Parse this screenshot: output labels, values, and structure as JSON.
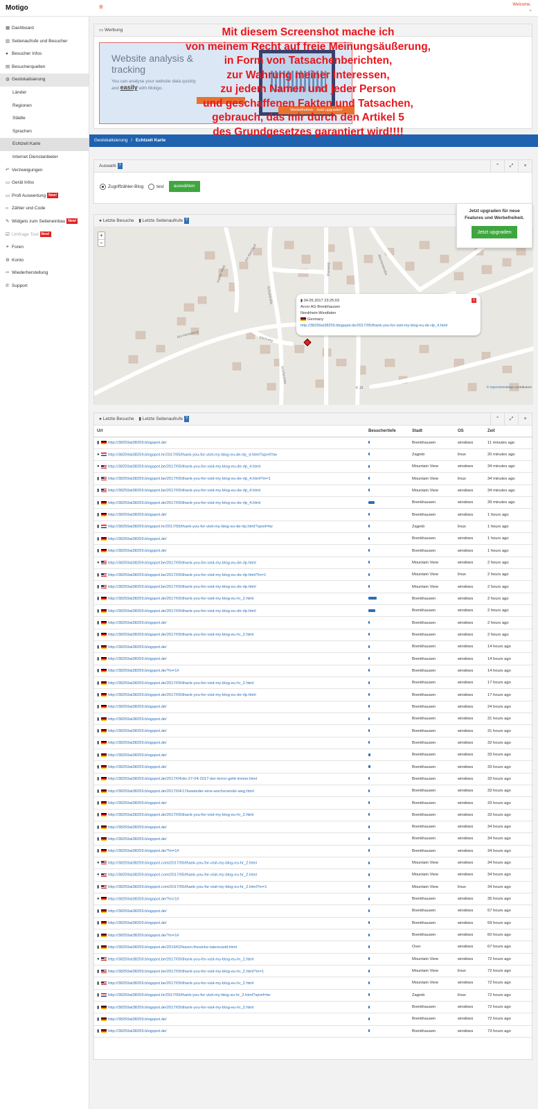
{
  "app": {
    "brand": "Motigo",
    "welcome": "Welcome,"
  },
  "sidebar": [
    {
      "label": "Dashboard",
      "icon": "dashboard-icon",
      "glyph": "▦"
    },
    {
      "label": "Seitenaufrufe und Besucher",
      "icon": "chart-icon",
      "glyph": "▥"
    },
    {
      "label": "Besucher Infos",
      "icon": "user-icon",
      "glyph": "●"
    },
    {
      "label": "Besucherquellen",
      "icon": "table-icon",
      "glyph": "▤"
    },
    {
      "label": "Geolokalisierung",
      "icon": "globe-icon",
      "glyph": "◍",
      "active": true
    },
    {
      "label": "Länder",
      "sub": true
    },
    {
      "label": "Regionen",
      "sub": true
    },
    {
      "label": "Städte",
      "sub": true
    },
    {
      "label": "Sprachen",
      "sub": true
    },
    {
      "label": "Echtzeit Karte",
      "sub": true,
      "active": true
    },
    {
      "label": "Internet Dienstanbieter",
      "sub": true
    },
    {
      "label": "Verzweigungen",
      "icon": "share-icon",
      "glyph": "↶"
    },
    {
      "label": "Gerät Infos",
      "icon": "device-icon",
      "glyph": "▭"
    },
    {
      "label": "Profi Auswertung",
      "icon": "monitor-icon",
      "glyph": "▭",
      "new": "New!"
    },
    {
      "label": "Zähler und Code",
      "icon": "code-icon",
      "glyph": "‹›"
    },
    {
      "label": "Widgets zum Seiteneinbau",
      "icon": "pencil-icon",
      "glyph": "✎",
      "new": "New!"
    },
    {
      "label": "Umfrage Tool",
      "icon": "survey-icon",
      "glyph": "☑",
      "new": "New!",
      "dim": true
    },
    {
      "label": "Foren",
      "icon": "link-icon",
      "glyph": "⚭"
    },
    {
      "label": "Konto",
      "icon": "gear-icon",
      "glyph": "⚙"
    },
    {
      "label": "Wiederherstellung",
      "icon": "wrench-icon",
      "glyph": "✑"
    },
    {
      "label": "Support",
      "icon": "phone-icon",
      "glyph": "✆"
    }
  ],
  "ad_panel": {
    "title": "Werbung",
    "ad_title": "Website analysis & tracking",
    "ad_text": "You can analyse your website data quickly and",
    "ad_text_em": "easily",
    "ad_text_end": "with Motigo.",
    "werbe_button": "Werbefreiheit - Jetzt upgraden!"
  },
  "overlay_lines": [
    "Mit diesem Screenshot mache ich",
    "von meinem Recht auf freie Meinungsäußerung,",
    "in Form von Tatsachenberichten,",
    "zur Wahrung meiner Interessen,",
    "zu jedem Namen und jeder Person",
    "und geschaffenen Fakten und Tatsachen,",
    "gebrauch, das mir durch den Artikel 5",
    "des Grundgesetzes garantiert wird!!!!"
  ],
  "breadcrumb": {
    "parent": "Geolokalisierung",
    "separator": "/",
    "current": "Echtzeit Karte"
  },
  "auswahl": {
    "title": "Auswahl",
    "options": [
      "Zugriffzähler-Blog",
      "test"
    ],
    "selected": 0,
    "button": "auswählen"
  },
  "map_panel": {
    "tab1": "Letzte Besuche",
    "tab2": "Letzte Seitenaufrufe",
    "attribution_pre": "©",
    "attribution_link": "OpenStreetMap",
    "attribution_post": "contributors",
    "popup": {
      "datetime": "04.05.2017 23:25:03",
      "isp": "Arcor AG Brenkhausen",
      "region": "Nordrhein-Westfalen",
      "country": "Germany",
      "url": "http://38259at38259.blogspot.de/2017/05/thank-you-for-visit-my-blog-eu-de-rlp_4.html",
      "close": "x"
    },
    "streets": [
      "Am Bachlauf",
      "Kiesweg",
      "Blumenstraße",
      "Hohler Weg",
      "Schulstraße",
      "Am Heineberg",
      "Stichweg",
      "K 18",
      "Schillerplatz"
    ]
  },
  "upsell": {
    "text": "Jetzt upgraden für neue Features und Werbefreiheit.",
    "button": "Jetzt upgraden"
  },
  "table_panel": {
    "tab1": "Letzte Besuche",
    "tab2": "Letzte Seitenaufrufe",
    "columns": {
      "url": "Url",
      "depth": "Besuchertiefe",
      "city": "Stadt",
      "os": "OS",
      "time": "Zeit"
    },
    "rows": [
      {
        "v": "doc",
        "f": "de",
        "url": "http://38259at38259.blogspot.de/",
        "d": 1,
        "city": "Brenkhausen",
        "os": "windows",
        "time": "11 minutes ago"
      },
      {
        "v": "user",
        "f": "hr",
        "url": "http://38259at38259.blogspot.hr/2017/05/thank-you-for-visit-my-blog-eu-de-rlp_4.html?spref=tw",
        "d": 1,
        "city": "Zagreb",
        "os": "linux",
        "time": "20 minutes ago"
      },
      {
        "v": "user",
        "f": "us",
        "url": "http://38259at38259.blogspot.be/2017/05/thank-you-for-visit-my-blog-eu-de-rlp_4.html",
        "d": 1,
        "city": "Mountain View",
        "os": "windows",
        "time": "34 minutes ago"
      },
      {
        "v": "doc",
        "f": "us",
        "url": "http://38259at38259.blogspot.be/2017/05/thank-you-for-visit-my-blog-eu-de-rlp_4.html?m=1",
        "d": 1,
        "city": "Mountain View",
        "os": "linux",
        "time": "34 minutes ago"
      },
      {
        "v": "doc",
        "f": "us",
        "url": "http://38259at38259.blogspot.be/2017/05/thank-you-for-visit-my-blog-eu-de-rlp_4.html",
        "d": 1,
        "city": "Mountain View",
        "os": "windows",
        "time": "34 minutes ago"
      },
      {
        "v": "doc",
        "f": "de",
        "url": "http://38259at38259.blogspot.de/2017/05/thank-you-for-visit-my-blog-eu-de-rlp_4.html",
        "d": 9,
        "city": "Brenkhausen",
        "os": "windows",
        "time": "39 minutes ago"
      },
      {
        "v": "doc",
        "f": "de",
        "url": "http://38259at38259.blogspot.de/",
        "d": 1,
        "city": "Brenkhausen",
        "os": "windows",
        "time": "1 hours ago"
      },
      {
        "v": "doc",
        "f": "hr",
        "url": "http://38259at38259.blogspot.hr/2017/05/thank-you-for-visit-my-blog-eu-de-rlp.html?spref=tw",
        "d": 1,
        "city": "Zagreb",
        "os": "linux",
        "time": "1 hours ago"
      },
      {
        "v": "doc",
        "f": "de",
        "url": "http://38259at38259.blogspot.de/",
        "d": 1,
        "city": "Brenkhausen",
        "os": "windows",
        "time": "1 hours ago"
      },
      {
        "v": "doc",
        "f": "de",
        "url": "http://38259at38259.blogspot.de/",
        "d": 1,
        "city": "Brenkhausen",
        "os": "windows",
        "time": "1 hours ago"
      },
      {
        "v": "user",
        "f": "us",
        "url": "http://38259at38259.blogspot.be/2017/05/thank-you-for-visit-my-blog-eu-de-rlp.html",
        "d": 1,
        "city": "Mountain View",
        "os": "windows",
        "time": "2 hours ago"
      },
      {
        "v": "doc",
        "f": "us",
        "url": "http://38259at38259.blogspot.be/2017/05/thank-you-for-visit-my-blog-eu-de-rlp.html?m=1",
        "d": 1,
        "city": "Mountain View",
        "os": "linux",
        "time": "2 hours ago"
      },
      {
        "v": "doc",
        "f": "us",
        "url": "http://38259at38259.blogspot.be/2017/05/thank-you-for-visit-my-blog-eu-de-rlp.html",
        "d": 1,
        "city": "Mountain View",
        "os": "windows",
        "time": "2 hours ago"
      },
      {
        "v": "doc",
        "f": "de",
        "url": "http://38259at38259.blogspot.de/2017/05/thank-you-for-visit-my-blog-eu-hr_2.html",
        "d": 12,
        "city": "Brenkhausen",
        "os": "windows",
        "time": "2 hours ago"
      },
      {
        "v": "doc",
        "f": "de",
        "url": "http://38259at38259.blogspot.de/2017/05/thank-you-for-visit-my-blog-eu-de-rlp.html",
        "d": 10,
        "city": "Brenkhausen",
        "os": "windows",
        "time": "2 hours ago"
      },
      {
        "v": "doc",
        "f": "de",
        "url": "http://38259at38259.blogspot.de/",
        "d": 1,
        "city": "Brenkhausen",
        "os": "windows",
        "time": "2 hours ago"
      },
      {
        "v": "doc",
        "f": "de",
        "url": "http://38259at38259.blogspot.de/2017/05/thank-you-for-visit-my-blog-eu-hr_2.html",
        "d": 1,
        "city": "Brenkhausen",
        "os": "windows",
        "time": "2 hours ago"
      },
      {
        "v": "doc",
        "f": "de",
        "url": "http://38259at38259.blogspot.de/",
        "d": 1,
        "city": "Brenkhausen",
        "os": "windows",
        "time": "14 hours ago"
      },
      {
        "v": "doc",
        "f": "de",
        "url": "http://38259at38259.blogspot.de/",
        "d": 1,
        "city": "Brenkhausen",
        "os": "windows",
        "time": "14 hours ago"
      },
      {
        "v": "doc",
        "f": "de",
        "url": "http://38259at38259.blogspot.de/?m=1#",
        "d": 1,
        "city": "Brenkhausen",
        "os": "windows",
        "time": "14 hours ago"
      },
      {
        "v": "doc",
        "f": "de",
        "url": "http://38259at38259.blogspot.de/2017/05/thank-you-for-visit-my-blog-eu-hr_2.html",
        "d": 2,
        "city": "Brenkhausen",
        "os": "windows",
        "time": "17 hours ago"
      },
      {
        "v": "doc",
        "f": "de",
        "url": "http://38259at38259.blogspot.de/2017/05/thank-you-for-visit-my-blog-eu-de-rlp.html",
        "d": 1,
        "city": "Brenkhausen",
        "os": "windows",
        "time": "17 hours ago"
      },
      {
        "v": "doc",
        "f": "de",
        "url": "http://38259at38259.blogspot.de/",
        "d": 1,
        "city": "Brenkhausen",
        "os": "windows",
        "time": "24 hours ago"
      },
      {
        "v": "doc",
        "f": "de",
        "url": "http://38259at38259.blogspot.de/",
        "d": 1,
        "city": "Brenkhausen",
        "os": "windows",
        "time": "31 hours ago"
      },
      {
        "v": "doc",
        "f": "de",
        "url": "http://38259at38259.blogspot.de/",
        "d": 1,
        "city": "Brenkhausen",
        "os": "windows",
        "time": "31 hours ago"
      },
      {
        "v": "doc",
        "f": "de",
        "url": "http://38259at38259.blogspot.de/",
        "d": 1,
        "city": "Brenkhausen",
        "os": "windows",
        "time": "32 hours ago"
      },
      {
        "v": "doc",
        "f": "de",
        "url": "http://38259at38259.blogspot.de/",
        "d": 3,
        "city": "Brenkhausen",
        "os": "windows",
        "time": "33 hours ago"
      },
      {
        "v": "doc",
        "f": "de",
        "url": "http://38259at38259.blogspot.de/",
        "d": 3,
        "city": "Brenkhausen",
        "os": "windows",
        "time": "33 hours ago"
      },
      {
        "v": "doc",
        "f": "de",
        "url": "http://38259at38259.blogspot.de/2017/04/do-27-04-2017-der-terror-geht-immer.html",
        "d": 2,
        "city": "Brenkhausen",
        "os": "windows",
        "time": "33 hours ago"
      },
      {
        "v": "doc",
        "f": "de",
        "url": "http://38259at38259.blogspot.de/2017/04/17kwwieder-eine-wochenende-weg.html",
        "d": 1,
        "city": "Brenkhausen",
        "os": "windows",
        "time": "33 hours ago"
      },
      {
        "v": "doc",
        "f": "de",
        "url": "http://38259at38259.blogspot.de/",
        "d": 1,
        "city": "Brenkhausen",
        "os": "windows",
        "time": "33 hours ago"
      },
      {
        "v": "doc",
        "f": "de",
        "url": "http://38259at38259.blogspot.de/2017/05/thank-you-for-visit-my-blog-eu-hr_2.html",
        "d": 1,
        "city": "Brenkhausen",
        "os": "windows",
        "time": "33 hours ago"
      },
      {
        "v": "doc",
        "f": "de",
        "url": "http://38259at38259.blogspot.de/",
        "d": 1,
        "city": "Brenkhausen",
        "os": "windows",
        "time": "34 hours ago"
      },
      {
        "v": "doc",
        "f": "de",
        "url": "http://38259at38259.blogspot.de/",
        "d": 1,
        "city": "Brenkhausen",
        "os": "windows",
        "time": "34 hours ago"
      },
      {
        "v": "doc",
        "f": "de",
        "url": "http://38259at38259.blogspot.de/?m=1#",
        "d": 1,
        "city": "Brenkhausen",
        "os": "windows",
        "time": "34 hours ago"
      },
      {
        "v": "user",
        "f": "us",
        "url": "http://38259at38259.blogspot.com/2017/05/thank-you-for-visit-my-blog-eu-hr_2.html",
        "d": 1,
        "city": "Mountain View",
        "os": "windows",
        "time": "34 hours ago"
      },
      {
        "v": "user",
        "f": "us",
        "url": "http://38259at38259.blogspot.com/2017/05/thank-you-for-visit-my-blog-eu-hr_2.html",
        "d": 1,
        "city": "Mountain View",
        "os": "windows",
        "time": "34 hours ago"
      },
      {
        "v": "doc",
        "f": "us",
        "url": "http://38259at38259.blogspot.com/2017/05/thank-you-for-visit-my-blog-eu-hr_2.html?m=1",
        "d": 1,
        "city": "Mountain View",
        "os": "linux",
        "time": "34 hours ago"
      },
      {
        "v": "user",
        "f": "de",
        "url": "http://38259at38259.blogspot.de/?m=1#",
        "d": 1,
        "city": "Brenkhausen",
        "os": "windows",
        "time": "35 hours ago"
      },
      {
        "v": "doc",
        "f": "de",
        "url": "http://38259at38259.blogspot.de/",
        "d": 1,
        "city": "Brenkhausen",
        "os": "windows",
        "time": "57 hours ago"
      },
      {
        "v": "doc",
        "f": "de",
        "url": "http://38259at38259.blogspot.de/",
        "d": 1,
        "city": "Brenkhausen",
        "os": "windows",
        "time": "59 hours ago"
      },
      {
        "v": "doc",
        "f": "de",
        "url": "http://38259at38259.blogspot.de/?m=1#",
        "d": 1,
        "city": "Brenkhausen",
        "os": "windows",
        "time": "60 hours ago"
      },
      {
        "v": "doc",
        "f": "de",
        "url": "http://38259at38259.blogspot.de/2016/02/karen-friesicke-tatersuizid.html",
        "d": 1,
        "city": "Over",
        "os": "windows",
        "time": "67 hours ago"
      },
      {
        "v": "user",
        "f": "us",
        "url": "http://38259at38259.blogspot.be/2017/05/thank-you-for-visit-my-blog-eu-hr_2.html",
        "d": 1,
        "city": "Mountain View",
        "os": "windows",
        "time": "72 hours ago"
      },
      {
        "v": "doc",
        "f": "us",
        "url": "http://38259at38259.blogspot.be/2017/05/thank-you-for-visit-my-blog-eu-hr_2.html?m=1",
        "d": 1,
        "city": "Mountain View",
        "os": "linux",
        "time": "72 hours ago"
      },
      {
        "v": "doc",
        "f": "us",
        "url": "http://38259at38259.blogspot.be/2017/05/thank-you-for-visit-my-blog-eu-hr_2.html",
        "d": 1,
        "city": "Mountain View",
        "os": "windows",
        "time": "72 hours ago"
      },
      {
        "v": "doc",
        "f": "hr",
        "url": "http://38259at38259.blogspot.hr/2017/05/thank-you-for-visit-my-blog-eu-hr_2.html?spref=tw",
        "d": 1,
        "city": "Zagreb",
        "os": "linux",
        "time": "72 hours ago"
      },
      {
        "v": "doc",
        "f": "de",
        "url": "http://38259at38259.blogspot.de/2017/05/thank-you-for-visit-my-blog-eu-hr_2.html",
        "d": 2,
        "city": "Brenkhausen",
        "os": "windows",
        "time": "72 hours ago"
      },
      {
        "v": "doc",
        "f": "de",
        "url": "http://38259at38259.blogspot.de/",
        "d": 1,
        "city": "Brenkhausen",
        "os": "windows",
        "time": "72 hours ago"
      },
      {
        "v": "doc",
        "f": "de",
        "url": "http://38259at38259.blogspot.de/",
        "d": 1,
        "city": "Brenkhausen",
        "os": "windows",
        "time": "73 hours ago"
      }
    ]
  }
}
